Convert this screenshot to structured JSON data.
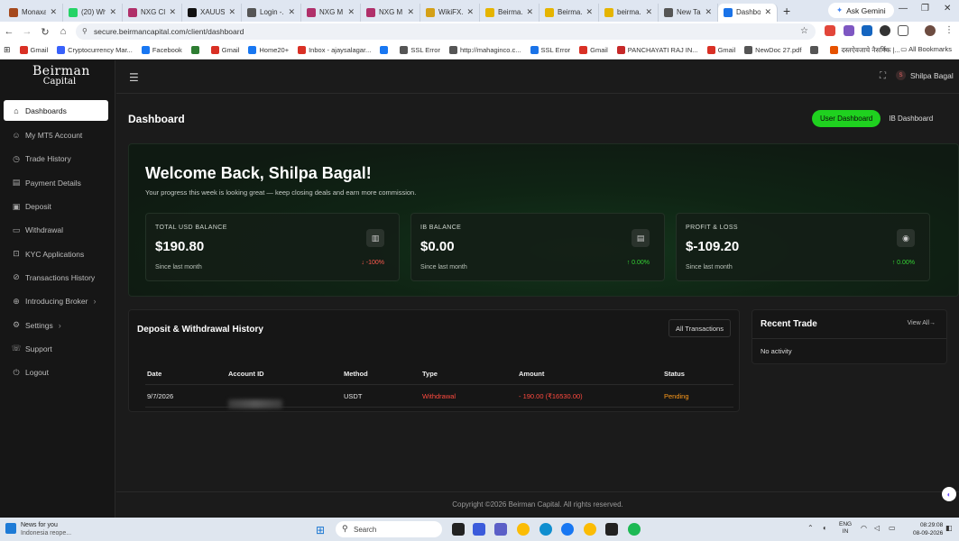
{
  "browser": {
    "tabs": [
      {
        "title": "Monaxa",
        "color": "#a5491d"
      },
      {
        "title": "(20) Wh...",
        "color": "#25d366"
      },
      {
        "title": "NXG Cli...",
        "color": "#b0306a"
      },
      {
        "title": "XAUUSD...",
        "color": "#111111"
      },
      {
        "title": "Login -...",
        "color": "#555555"
      },
      {
        "title": "NXG M...",
        "color": "#b0306a"
      },
      {
        "title": "NXG M...",
        "color": "#b0306a"
      },
      {
        "title": "WikiFX...",
        "color": "#d4a017"
      },
      {
        "title": "Beirma...",
        "color": "#e5b400"
      },
      {
        "title": "Beirma...",
        "color": "#e5b400"
      },
      {
        "title": "beirma...",
        "color": "#e5b400"
      },
      {
        "title": "New Tab",
        "color": "#555555"
      },
      {
        "title": "Dashbo...",
        "color": "#1a73e8"
      }
    ],
    "active_tab_index": 12,
    "gemini_label": "Ask Gemini",
    "url": "secure.beirmancapital.com/client/dashboard",
    "bookmarks": [
      {
        "label": "Gmail",
        "color": "#d93025"
      },
      {
        "label": "Cryptocurrency Mar...",
        "color": "#3861fb"
      },
      {
        "label": "Facebook",
        "color": "#1877f2"
      },
      {
        "label": "",
        "color": "#2e7d32"
      },
      {
        "label": "Gmail",
        "color": "#d93025"
      },
      {
        "label": "Home20+",
        "color": "#1877f2"
      },
      {
        "label": "Inbox - ajaysalagar...",
        "color": "#d93025"
      },
      {
        "label": "",
        "color": "#1877f2"
      },
      {
        "label": "SSL Error",
        "color": "#555555"
      },
      {
        "label": "http://mahaginco.c...",
        "color": "#555555"
      },
      {
        "label": "SSL Error",
        "color": "#1a73e8"
      },
      {
        "label": "Gmail",
        "color": "#d93025"
      },
      {
        "label": "PANCHAYATI RAJ IN...",
        "color": "#c62828"
      },
      {
        "label": "Gmail",
        "color": "#d93025"
      },
      {
        "label": "NewDoc 27.pdf",
        "color": "#555555"
      },
      {
        "label": "",
        "color": "#555555"
      },
      {
        "label": "दस्तऐवजाचे नैसर्गिक |...",
        "color": "#e65100"
      }
    ],
    "all_bookmarks_label": "All Bookmarks"
  },
  "app": {
    "brand_line1": "Beirman",
    "brand_line2": "Capital",
    "nav": [
      {
        "label": "Dashboards",
        "icon": "⌂",
        "icon_name": "home-icon",
        "active": true,
        "chevron": false
      },
      {
        "label": "My MT5 Account",
        "icon": "☺",
        "icon_name": "user-icon",
        "active": false,
        "chevron": false
      },
      {
        "label": "Trade History",
        "icon": "◷",
        "icon_name": "clock-icon",
        "active": false,
        "chevron": false
      },
      {
        "label": "Payment Details",
        "icon": "▤",
        "icon_name": "card-icon",
        "active": false,
        "chevron": false
      },
      {
        "label": "Deposit",
        "icon": "▣",
        "icon_name": "deposit-icon",
        "active": false,
        "chevron": false
      },
      {
        "label": "Withdrawal",
        "icon": "▭",
        "icon_name": "withdrawal-icon",
        "active": false,
        "chevron": false
      },
      {
        "label": "KYC Applications",
        "icon": "⊡",
        "icon_name": "kyc-icon",
        "active": false,
        "chevron": false
      },
      {
        "label": "Transactions History",
        "icon": "⊘",
        "icon_name": "transactions-icon",
        "active": false,
        "chevron": false
      },
      {
        "label": "Introducing Broker",
        "icon": "⊕",
        "icon_name": "broker-icon",
        "active": false,
        "chevron": true
      },
      {
        "label": "Settings",
        "icon": "⚙",
        "icon_name": "settings-icon",
        "active": false,
        "chevron": true
      },
      {
        "label": "Support",
        "icon": "☏",
        "icon_name": "support-icon",
        "active": false,
        "chevron": false
      },
      {
        "label": "Logout",
        "icon": "⏻",
        "icon_name": "logout-icon",
        "active": false,
        "chevron": false
      }
    ],
    "user_initial": "S",
    "user_name": "Shilpa Bagal",
    "page_title": "Dashboard",
    "toggle": {
      "user": "User Dashboard",
      "ib": "IB Dashboard"
    },
    "hero": {
      "welcome": "Welcome Back, Shilpa Bagal!",
      "subtitle": "Your progress this week is looking great — keep closing deals and earn more commission.",
      "stats": [
        {
          "label": "TOTAL USD BALANCE",
          "value": "$190.80",
          "since": "Since last month",
          "change": "↓ -100%",
          "trend": "neg",
          "icon": "▥",
          "icon_name": "wallet-icon"
        },
        {
          "label": "IB BALANCE",
          "value": "$0.00",
          "since": "Since last month",
          "change": "↑ 0.00%",
          "trend": "pos",
          "icon": "▤",
          "icon_name": "ledger-icon"
        },
        {
          "label": "PROFIT & LOSS",
          "value": "$-109.20",
          "since": "Since last month",
          "change": "↑ 0.00%",
          "trend": "pos",
          "icon": "◉",
          "icon_name": "pnl-icon"
        }
      ]
    },
    "history": {
      "title": "Deposit & Withdrawal History",
      "all_transactions": "All Transactions",
      "columns": [
        "Date",
        "Account ID",
        "Method",
        "Type",
        "Amount",
        "Status"
      ],
      "rows": [
        {
          "date": "9/7/2026",
          "account_id": "",
          "method": "USDT",
          "type": "Withdrawal",
          "amount": "- 190.00 (₹16530.00)",
          "status": "Pending"
        }
      ]
    },
    "recent_trade": {
      "title": "Recent Trade",
      "view_all": "View All→",
      "empty": "No activity"
    },
    "footer": "Copyright ©2026 Beirman Capital. All rights reserved."
  },
  "taskbar": {
    "news_title": "News for you",
    "news_sub": "Indonesia reope...",
    "search_placeholder": "Search",
    "lang1": "ENG",
    "lang2": "IN",
    "time": "08:29:08",
    "date": "08-09-2026"
  }
}
